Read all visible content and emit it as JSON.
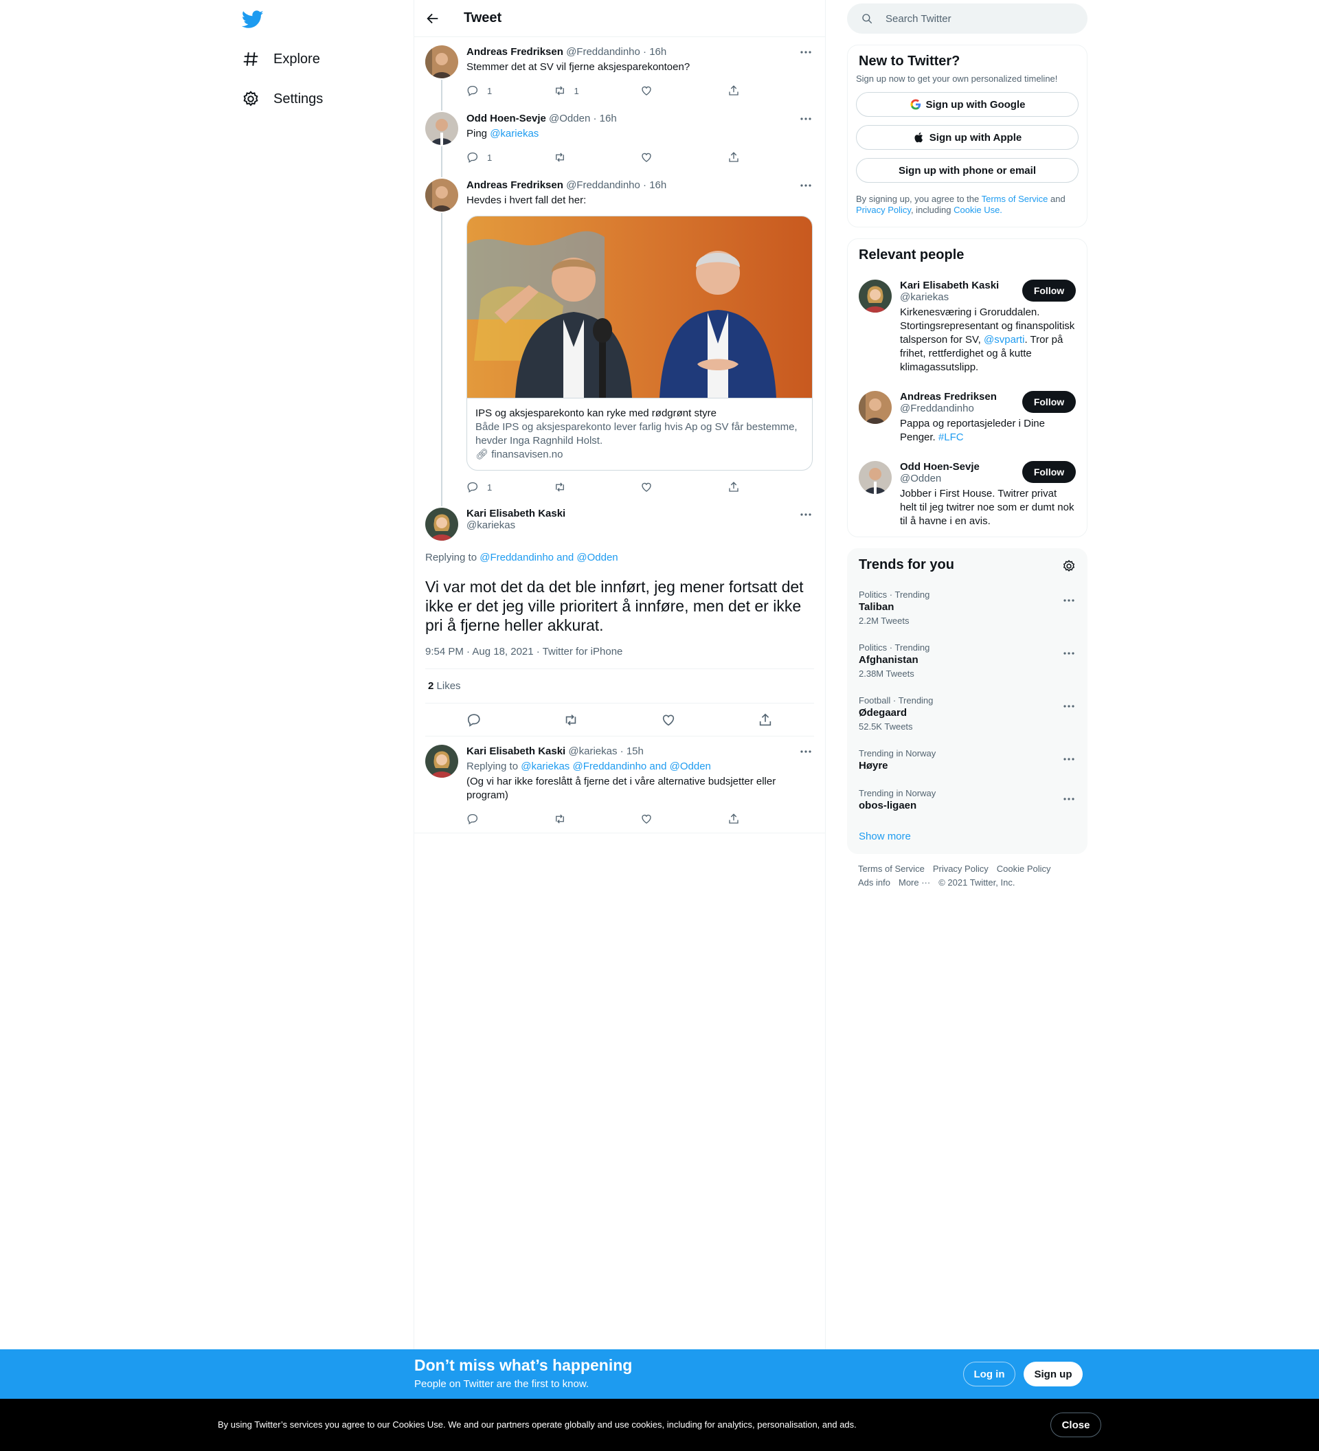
{
  "colors": {
    "accent": "#1d9bf0",
    "text": "#0f1419",
    "muted": "#536471"
  },
  "nav": {
    "logo": "twitter-bird-icon",
    "items": [
      {
        "label": "Explore",
        "icon": "hashtag-icon"
      },
      {
        "label": "Settings",
        "icon": "gear-icon"
      }
    ]
  },
  "header": {
    "title": "Tweet"
  },
  "thread": [
    {
      "name": "Andreas Fredriksen",
      "handle": "@Freddandinho",
      "time": "· 16h",
      "text": "Stemmer det at SV vil fjerne aksjesparekontoen?",
      "replies": "1",
      "retweets": "1",
      "likes": ""
    },
    {
      "name": "Odd Hoen-Sevje",
      "handle": "@Odden",
      "time": "· 16h",
      "text_prefix": "Ping ",
      "mention": "@kariekas",
      "replies": "1",
      "retweets": "",
      "likes": ""
    },
    {
      "name": "Andreas Fredriksen",
      "handle": "@Freddandinho",
      "time": "· 16h",
      "text": "Hevdes i hvert fall det her:",
      "card": {
        "title": "IPS og aksjesparekonto kan ryke med rødgrønt styre",
        "description": "Både IPS og aksjesparekonto lever farlig hvis Ap og SV får bestemme, hevder Inga Ragnhild Holst.",
        "link": "finansavisen.no"
      },
      "replies": "1",
      "retweets": "",
      "likes": ""
    }
  ],
  "main": {
    "name": "Kari Elisabeth Kaski",
    "handle": "@kariekas",
    "replying_label": "Replying to",
    "replying_to": "@Freddandinho and @Odden",
    "text": "Vi var mot det da det ble innført, jeg mener fortsatt det ikke er det jeg ville prioritert å innføre, men det er ikke pri å fjerne heller akkurat.",
    "meta": "9:54 PM · Aug 18, 2021 · Twitter for iPhone",
    "likes_count": "2",
    "likes_label": "Likes"
  },
  "reply": {
    "name": "Kari Elisabeth Kaski",
    "handle": "@kariekas",
    "time": "· 15h",
    "replying_label": "Replying to",
    "replying_to": "@kariekas @Freddandinho and @Odden",
    "text": "(Og vi har ikke foreslått å fjerne det i våre alternative budsjetter eller program)"
  },
  "search": {
    "placeholder": "Search Twitter"
  },
  "new_to_twitter": {
    "title": "New to Twitter?",
    "subtitle": "Sign up now to get your own personalized timeline!",
    "google": "Sign up with Google",
    "apple": "Sign up with Apple",
    "phone": "Sign up with phone or email",
    "legal_1": "By signing up, you agree to the ",
    "terms": "Terms of Service",
    "legal_2": " and ",
    "privacy": "Privacy Policy",
    "legal_3": ", including ",
    "cookie": "Cookie Use."
  },
  "relevant": {
    "title": "Relevant people",
    "follow_label": "Follow",
    "people": [
      {
        "name": "Kari Elisabeth Kaski",
        "handle": "@kariekas",
        "bio_1": "Kirkenesværing i Groruddalen. Stortingsrepresentant og finanspolitisk talsperson for SV, ",
        "bio_link": "@svparti",
        "bio_2": ". Tror på frihet, rettferdighet og å kutte klimagassutslipp."
      },
      {
        "name": "Andreas Fredriksen",
        "handle": "@Freddandinho",
        "bio_1": "Pappa og reportasjeleder i Dine Penger. ",
        "bio_link": "#LFC",
        "bio_2": ""
      },
      {
        "name": "Odd Hoen-Sevje",
        "handle": "@Odden",
        "bio_1": "Jobber i First House. Twitrer privat helt til jeg twitrer noe som er dumt nok til å havne i en avis.",
        "bio_link": "",
        "bio_2": ""
      }
    ]
  },
  "trends": {
    "title": "Trends for you",
    "items": [
      {
        "context": "Politics · Trending",
        "name": "Taliban",
        "count": "2.2M Tweets"
      },
      {
        "context": "Politics · Trending",
        "name": "Afghanistan",
        "count": "2.38M Tweets"
      },
      {
        "context": "Football · Trending",
        "name": "Ødegaard",
        "count": "52.5K Tweets"
      },
      {
        "context": "Trending in Norway",
        "name": "Høyre",
        "count": ""
      },
      {
        "context": "Trending in Norway",
        "name": "obos-ligaen",
        "count": ""
      }
    ],
    "show_more": "Show more"
  },
  "footer": {
    "links": [
      "Terms of Service",
      "Privacy Policy",
      "Cookie Policy",
      "Ads info",
      "More ···",
      "© 2021 Twitter, Inc."
    ]
  },
  "banner": {
    "title": "Don’t miss what’s happening",
    "subtitle": "People on Twitter are the first to know.",
    "login": "Log in",
    "signup": "Sign up"
  },
  "cookies": {
    "text": "By using Twitter’s services you agree to our Cookies Use. We and our partners operate globally and use cookies, including for analytics, personalisation, and ads.",
    "close": "Close"
  }
}
